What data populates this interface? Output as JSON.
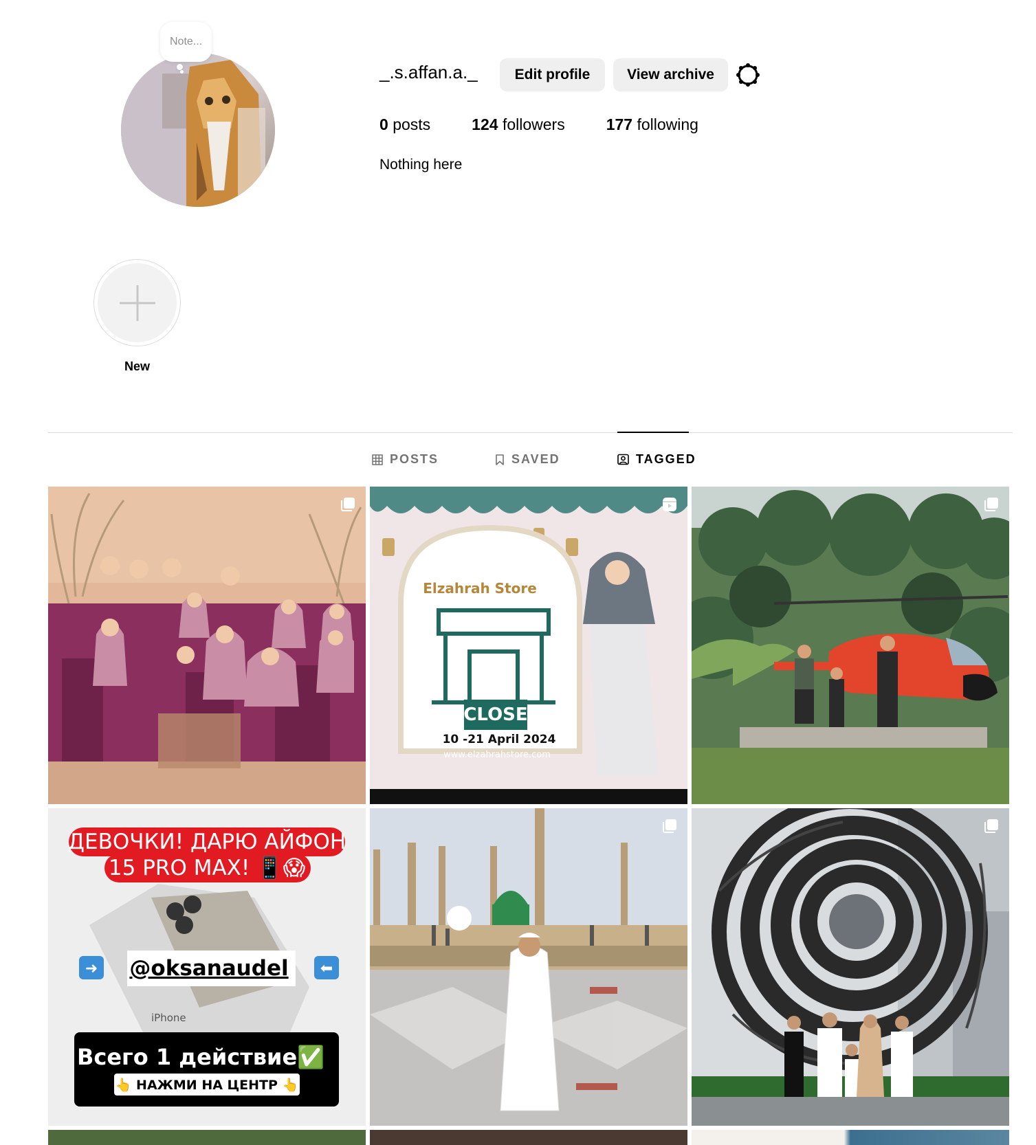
{
  "profile": {
    "note_placeholder": "Note...",
    "username": "_.s.affan.a._",
    "edit_profile_label": "Edit profile",
    "view_archive_label": "View archive",
    "settings_icon": "gear-icon",
    "stats": {
      "posts_count": "0",
      "posts_label": "posts",
      "followers_count": "124",
      "followers_label": "followers",
      "following_count": "177",
      "following_label": "following"
    },
    "bio": "Nothing here"
  },
  "highlights": {
    "new_label": "New"
  },
  "tabs": [
    {
      "label": "POSTS",
      "icon": "grid-icon",
      "active": false
    },
    {
      "label": "SAVED",
      "icon": "bookmark-icon",
      "active": false
    },
    {
      "label": "TAGGED",
      "icon": "tagged-user-icon",
      "active": true
    }
  ],
  "posts": [
    {
      "icon": "carousel-icon",
      "subject": "family-photo"
    },
    {
      "icon": "reel-icon",
      "subject": "store-closed-ad",
      "texts": {
        "close": "CLOSE",
        "dates": "10 -21 April 2024",
        "brand": "Elzahrah Store",
        "url": "www.elzahrahstore.com"
      }
    },
    {
      "icon": "carousel-icon",
      "subject": "helicopter-photo"
    },
    {
      "icon": "",
      "subject": "iphone-giveaway-ad",
      "texts": {
        "headline1": "ДЕВОЧКИ! ДАРЮ АЙФОН",
        "headline2": "15 PRO MAX! 📱😱",
        "handle": "@oksanaudel",
        "footer1": "Всего 1 действие✅",
        "footer2": "👆 НАЖМИ НА ЦЕНТР 👆",
        "box_text": "iPhone"
      }
    },
    {
      "icon": "carousel-icon",
      "subject": "mosque-photo"
    },
    {
      "icon": "carousel-icon",
      "subject": "sculpture-photo"
    }
  ],
  "colors": {
    "button_bg": "#efefef",
    "border": "#dbdbdb",
    "muted_text": "#737373"
  }
}
